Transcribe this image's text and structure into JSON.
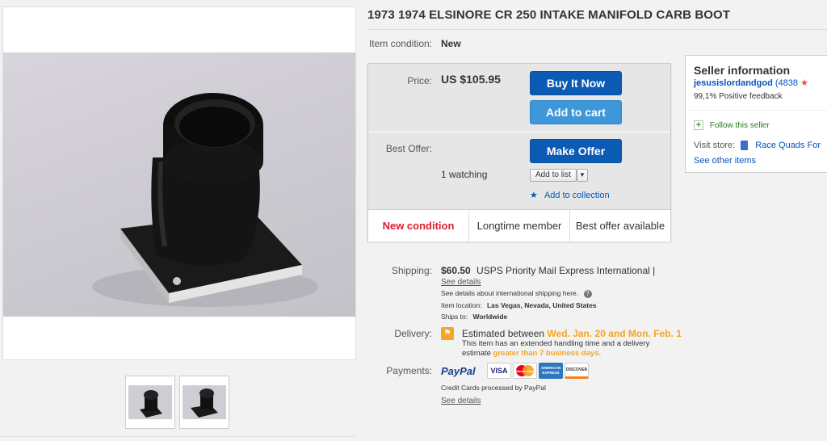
{
  "listing": {
    "title": "1973 1974 ELSINORE CR 250 INTAKE MANIFOLD CARB BOOT",
    "condition_label": "Item condition:",
    "condition_value": "New"
  },
  "buy": {
    "price_label": "Price:",
    "price_value": "US $105.95",
    "buy_now": "Buy It Now",
    "add_to_cart": "Add to cart",
    "best_offer_label": "Best Offer:",
    "make_offer": "Make Offer",
    "watching": "1 watching",
    "add_to_list": "Add to list",
    "add_to_collection": "Add to collection"
  },
  "badges": [
    "New condition",
    "Longtime member",
    "Best offer available"
  ],
  "shipping": {
    "label": "Shipping:",
    "cost": "$60.50",
    "method": "USPS Priority Mail Express International |",
    "see_details": "See details",
    "intl_note": "See details about international shipping here.",
    "location_label": "Item location:",
    "location": "Las Vegas, Nevada, United States",
    "ships_to_label": "Ships to:",
    "ships_to": "Worldwide"
  },
  "delivery": {
    "label": "Delivery:",
    "estimated": "Estimated between",
    "dates": "Wed. Jan. 20 and Mon. Feb. 1",
    "note1": "This item has an extended handling time and a delivery",
    "note2_prefix": "estimate",
    "note2_highlight": "greater than 7 business days."
  },
  "payments": {
    "label": "Payments:",
    "paypal": "PayPal",
    "cards": [
      "VISA",
      "MasterCard",
      "AMERICAN EXPRESS",
      "DISCOVER"
    ],
    "processed": "Credit Cards processed by PayPal",
    "see_details": "See details"
  },
  "seller": {
    "heading": "Seller information",
    "username": "jesusislordandgod",
    "score": "(4838",
    "feedback": "99,1% Positive feedback",
    "follow": "Follow this seller",
    "visit_label": "Visit store:",
    "store_name": "Race Quads For",
    "other_items": "See other items"
  },
  "colors": {
    "primary_button": "#0b5bb5",
    "secondary_button": "#3d97d9",
    "link": "#0654ba",
    "alert_red": "#dd1e31",
    "highlight_orange": "#f5a623"
  },
  "icons": [
    "product-photo",
    "info-icon",
    "flag-icon",
    "star-icon",
    "plus-icon",
    "store-icon",
    "dropdown-arrow-icon"
  ]
}
